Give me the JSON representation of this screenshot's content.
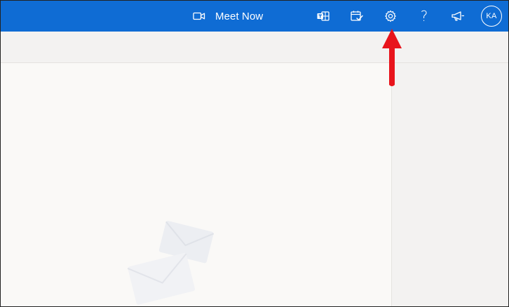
{
  "topbar": {
    "meet_now_label": "Meet Now",
    "avatar_initials": "KA",
    "help_glyph": "?",
    "icons": {
      "meet_now": "video-camera-icon",
      "teams": "teams-icon",
      "todo": "calendar-check-icon",
      "settings": "gear-icon",
      "help": "help-icon",
      "feedback": "megaphone-icon"
    }
  },
  "annotation": {
    "type": "red-arrow",
    "points_to": "settings",
    "color": "#e8141c"
  },
  "colors": {
    "topbar": "#0f6cd4",
    "reading_pane": "#faf9f7",
    "toolbar": "#f3f2f1"
  }
}
